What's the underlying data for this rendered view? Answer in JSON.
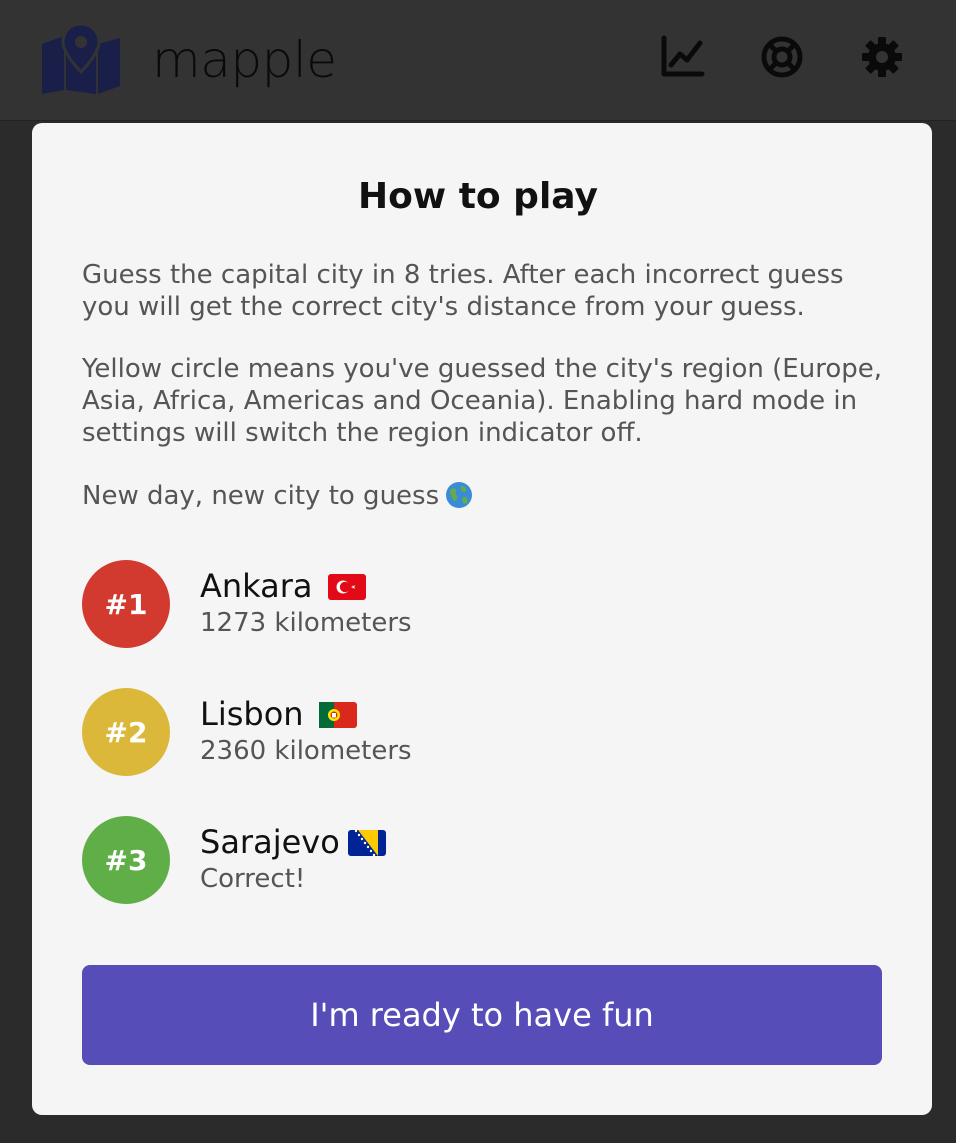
{
  "app": {
    "title": "mapple"
  },
  "header": {
    "icons": {
      "stats": "chart-line-icon",
      "help": "lifebuoy-icon",
      "settings": "gear-icon"
    }
  },
  "modal": {
    "title": "How to play",
    "paragraphs": [
      "Guess the capital city in 8 tries. After each incorrect guess you will get the correct city's distance from your guess.",
      "Yellow circle means you've guessed the city's region (Europe, Asia, Africa, Americas and Oceania). Enabling hard mode in settings will switch the region indicator off.",
      "New day, new city to guess"
    ],
    "examples": [
      {
        "rank": "#1",
        "city": "Ankara",
        "flag": "turkey-flag",
        "result": "1273 kilometers",
        "color": "#d23a30"
      },
      {
        "rank": "#2",
        "city": "Lisbon",
        "flag": "portugal-flag",
        "result": "2360 kilometers",
        "color": "#dbb83a"
      },
      {
        "rank": "#3",
        "city": "Sarajevo",
        "flag": "bosnia-flag",
        "result": "Correct!",
        "color": "#5fae47"
      }
    ],
    "button_label": "I'm ready to have fun"
  },
  "colors": {
    "header_bg": "#333333",
    "modal_bg": "#f5f5f5",
    "accent": "#564db8",
    "logo": "#1a1f4a"
  }
}
